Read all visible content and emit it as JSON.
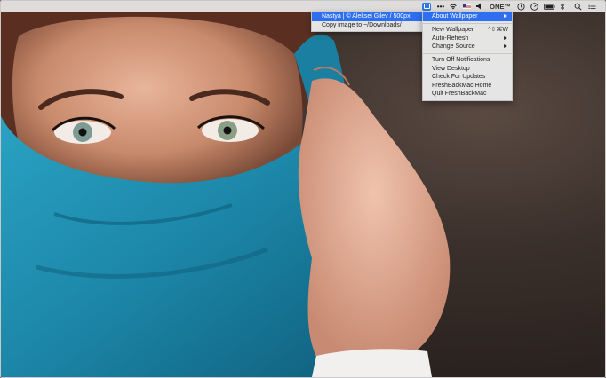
{
  "menubar": {
    "app_icon": "freshback-icon",
    "more_label": "•••",
    "one_label": "ONE™",
    "icons": [
      "wifi-icon",
      "flag-us-icon",
      "volume-icon",
      "time-machine-icon",
      "clock-icon",
      "battery-icon",
      "bluetooth-icon",
      "search-icon",
      "list-icon"
    ]
  },
  "info_menu": {
    "items": [
      {
        "label": "Nastya | © Aleksei Gilev / 500px",
        "highlighted": true
      },
      {
        "label": "Copy image to ~/Downloads/",
        "highlighted": false
      }
    ]
  },
  "app_menu": {
    "items": [
      {
        "label": "About Wallpaper",
        "highlighted": true,
        "submenu": true
      },
      {
        "label": "New Wallpaper",
        "shortcut": "^⇧⌘W"
      },
      {
        "label": "Auto-Refresh",
        "submenu": true
      },
      {
        "label": "Change Source",
        "submenu": true
      },
      {
        "label": "Turn Off Notifications"
      },
      {
        "label": "View Desktop"
      },
      {
        "label": "Check For Updates"
      },
      {
        "label": "FreshBackMac Home"
      },
      {
        "label": "Quit FreshBackMac"
      }
    ]
  },
  "colors": {
    "highlight": "#2d6ff0",
    "scarf": "#1f8fb0"
  }
}
